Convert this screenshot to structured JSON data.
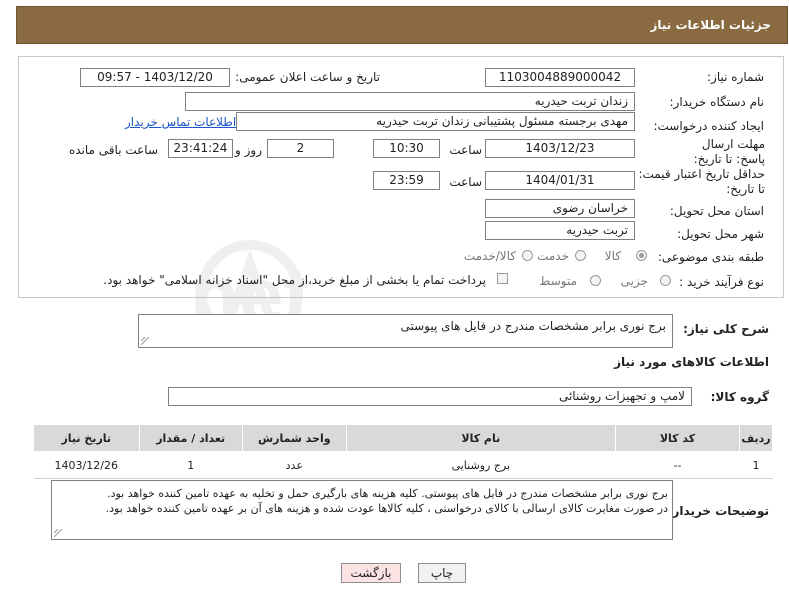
{
  "page_title": "جزئیات اطلاعات نیاز",
  "fields": {
    "need_number_label": "شماره نیاز:",
    "need_number": "1103004889000042",
    "announce_label": "تاریخ و ساعت اعلان عمومی:",
    "announce_value": "1403/12/20 - 09:57",
    "buyer_org_label": "نام دستگاه خریدار:",
    "buyer_org": "زندان تربت حیدریه",
    "creator_label": "ایجاد کننده درخواست:",
    "creator": "مهدی برجسته مسئول پشتیبانی زندان تربت حیدریه",
    "contact_link": "اطلاعات تماس خریدار",
    "deadline_label": "مهلت ارسال پاسخ: تا تاریخ:",
    "deadline_date": "1403/12/23",
    "time_label": "ساعت",
    "deadline_time": "10:30",
    "days_value": "2",
    "days_and_label": "روز و",
    "remaining_time": "23:41:24",
    "remaining_label": "ساعت باقی مانده",
    "validity_label": "حداقل تاریخ اعتبار قیمت: تا تاریخ:",
    "validity_date": "1404/01/31",
    "validity_time": "23:59",
    "province_label": "استان محل تحویل:",
    "province": "خراسان رضوی",
    "city_label": "شهر محل تحویل:",
    "city": "تربت حیدریه",
    "category_label": "طبقه بندی موضوعی:",
    "category_options": [
      "کالا",
      "خدمت",
      "کالا/خدمت"
    ],
    "category_selected": "کالا",
    "purchase_type_label": "نوع فرآیند خرید :",
    "purchase_options": [
      "جزیی",
      "متوسط"
    ],
    "payment_note": "پرداخت تمام یا بخشی از مبلغ خرید،از محل \"اسناد خزانه اسلامی\" خواهد بود."
  },
  "description": {
    "label": "شرح کلی نیاز:",
    "value": "برج نوری برابر مشخصات مندرج در فایل های پیوستی"
  },
  "goods_section_title": "اطلاعات کالاهای مورد نیاز",
  "goods_group": {
    "label": "گروه کالا:",
    "value": "لامپ و تجهیزات روشنائی"
  },
  "table": {
    "headers": [
      "ردیف",
      "کد کالا",
      "نام کالا",
      "واحد شمارش",
      "تعداد / مقدار",
      "تاریخ نیاز"
    ],
    "rows": [
      [
        "1",
        "--",
        "برج روشنایی",
        "عدد",
        "1",
        "1403/12/26"
      ]
    ]
  },
  "buyer_notes": {
    "label": "توضیحات خریدار:",
    "line1": "برج نوری برابر مشخصات مندرج در فایل های پیوستی. کلیه هزینه های بارگیری حمل و تخلیه به عهده تامین کننده خواهد بود.",
    "line2": "در صورت مغایرت کالای ارسالی با کالای درخواستی ، کلیه کالاها عودت شده و هزینه های آن بر عهده تامین کننده خواهد بود."
  },
  "buttons": {
    "print": "چاپ",
    "back": "بازگشت"
  },
  "watermark_text": "AriaTender.net",
  "colors": {
    "header_bg": "#8a6b41",
    "link": "#1a56c9",
    "back_button_bg": "#fbe3e3"
  }
}
